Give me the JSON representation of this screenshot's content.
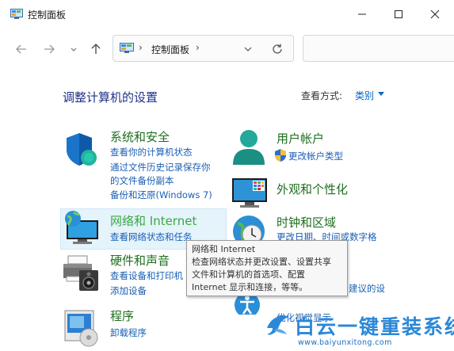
{
  "window": {
    "title": "控制面板"
  },
  "address": {
    "path_item": "控制面板"
  },
  "main": {
    "title": "调整计算机的设置"
  },
  "view_by": {
    "label": "查看方式:",
    "value": "类别"
  },
  "categories": {
    "system_security": {
      "title": "系统和安全",
      "links": [
        "查看你的计算机状态",
        "通过文件历史记录保存你",
        "的文件备份副本",
        "备份和还原(Windows 7)"
      ]
    },
    "user_accounts": {
      "title": "用户帐户",
      "links": [
        "更改帐户类型"
      ]
    },
    "appearance": {
      "title": "外观和个性化"
    },
    "network": {
      "title": "网络和 Internet",
      "links": [
        "查看网络状态和任务"
      ]
    },
    "clock_region": {
      "title": "时钟和区域",
      "links": [
        "更改日期、时间或数字格"
      ]
    },
    "hardware_sound": {
      "title": "硬件和声音",
      "links": [
        "查看设备和打印机",
        "添加设备"
      ]
    },
    "ease_access": {
      "links": [
        "建议的设",
        "优化视觉显示"
      ]
    },
    "programs": {
      "title": "程序",
      "links": [
        "卸载程序"
      ]
    }
  },
  "tooltip": {
    "lines": [
      "网络和 Internet",
      "检查网络状态并更改设置、设置共享",
      "文件和计算机的首选项、配置",
      "Internet 显示和连接，等等。"
    ]
  },
  "watermark": {
    "text": "白云一键重装系统",
    "url": "www.baiyunxitong.com"
  },
  "colors": {
    "link": "#1a5fb4",
    "category_title": "#1e6e1e",
    "page_title": "#1e3287",
    "watermark": "#2b88d8"
  }
}
